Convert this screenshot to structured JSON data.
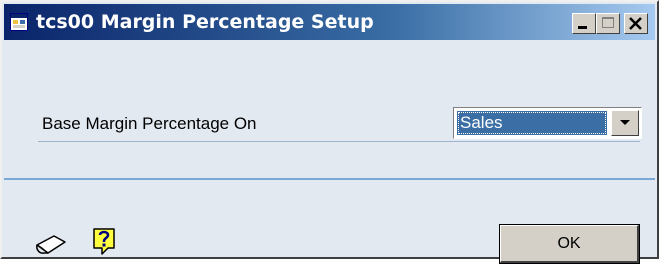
{
  "window": {
    "title": "tcs00 Margin Percentage Setup",
    "title_icon": "window-app-icon",
    "controls": [
      "minimize-icon",
      "maximize-icon",
      "close-icon"
    ]
  },
  "form": {
    "base_margin_label": "Base Margin Percentage On",
    "base_margin_value": "Sales"
  },
  "footer": {
    "note_icon": "note-icon",
    "help_icon": "help-icon",
    "ok_label": "OK"
  },
  "colors": {
    "titlebar_start": "#0a246a",
    "titlebar_end": "#a6caf0",
    "dialog_bg": "#e3e9f1",
    "selection": "#3a6ea5",
    "separator": "#7aa7d6"
  }
}
